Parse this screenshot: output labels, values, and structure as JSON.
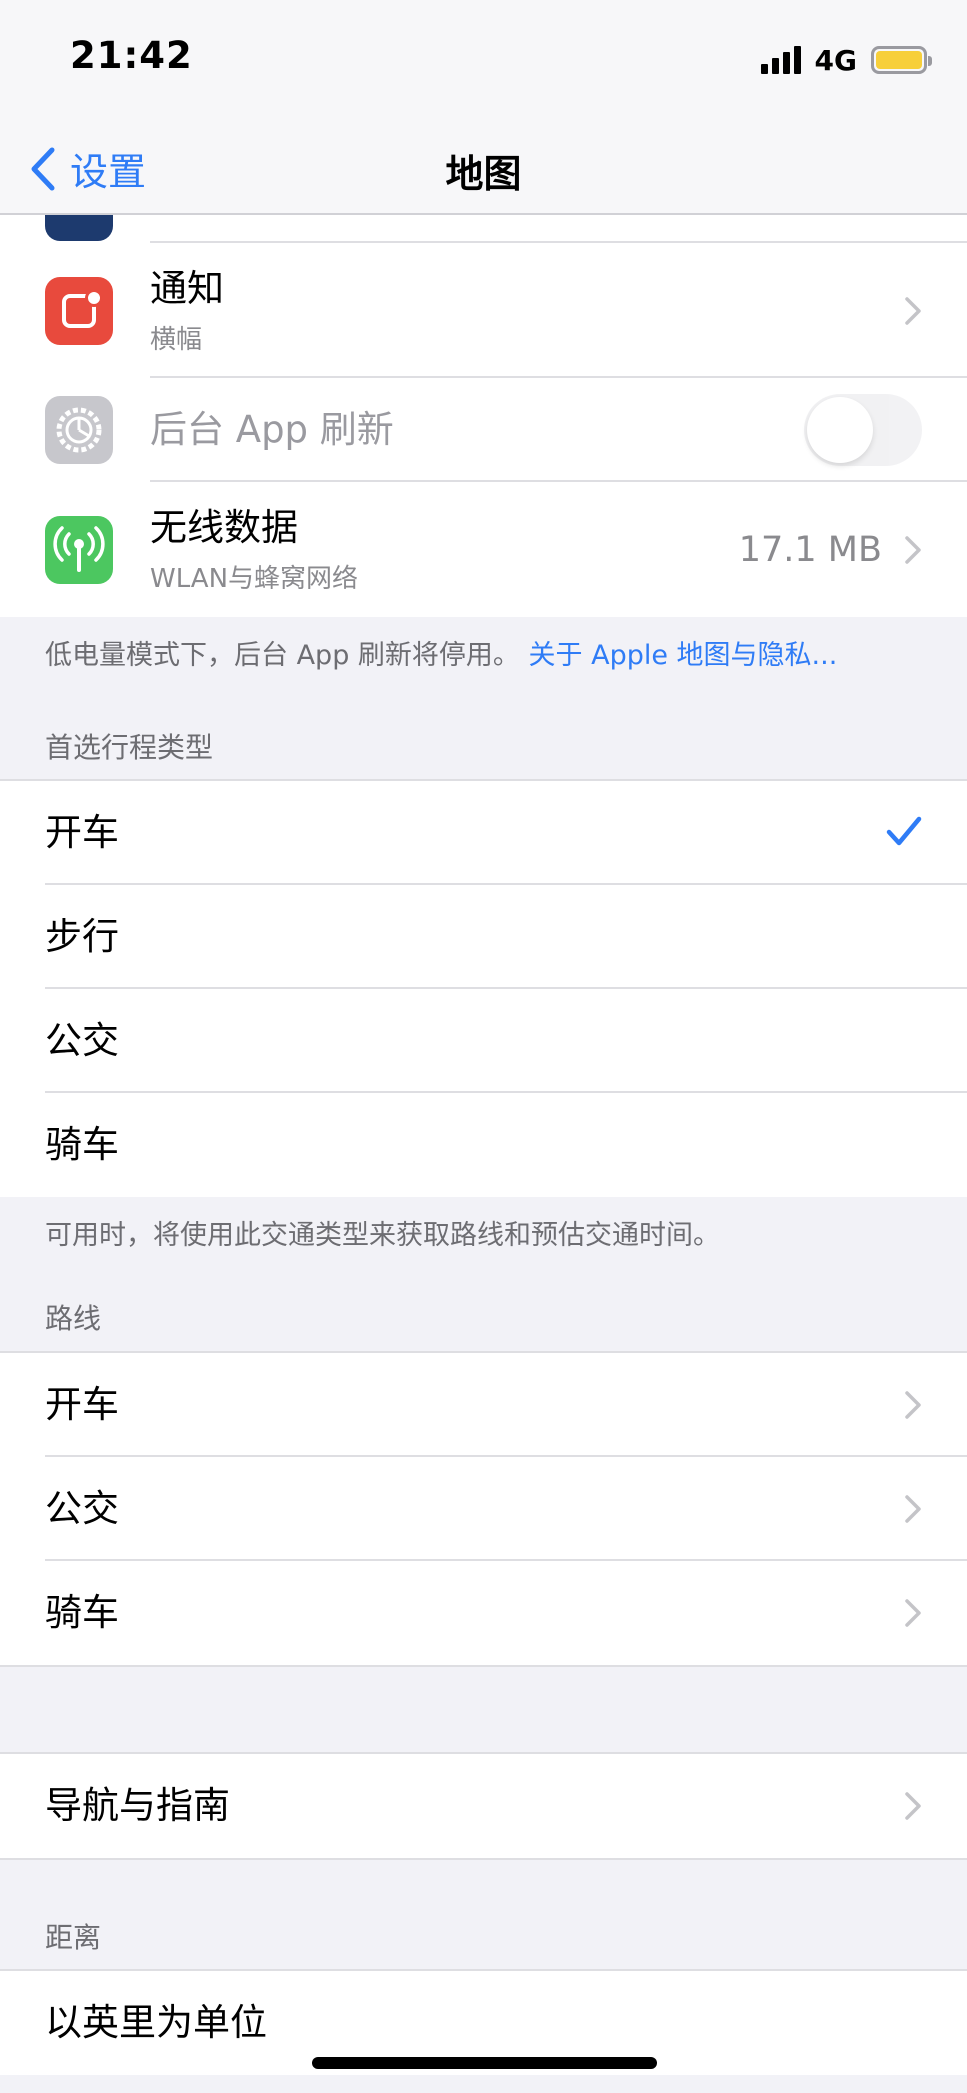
{
  "status": {
    "time": "21:42",
    "network": "4G"
  },
  "nav": {
    "back_label": "设置",
    "title": "地图"
  },
  "permissions": [
    {
      "title": "通知",
      "subtitle": "横幅",
      "icon": "notifications-icon"
    },
    {
      "title": "后台 App 刷新",
      "icon": "gear-icon",
      "toggle": "off"
    },
    {
      "title": "无线数据",
      "subtitle": "WLAN与蜂窝网络",
      "value": "17.1 MB",
      "icon": "cellular-data-icon"
    }
  ],
  "permissions_footer": {
    "text": "低电量模式下，后台 App 刷新将停用。",
    "link": "关于 Apple 地图与隐私..."
  },
  "preferred_transport": {
    "header": "首选行程类型",
    "items": [
      {
        "label": "开车",
        "selected": true
      },
      {
        "label": "步行"
      },
      {
        "label": "公交"
      },
      {
        "label": "骑车"
      }
    ],
    "footer": "可用时，将使用此交通类型来获取路线和预估交通时间。"
  },
  "routes": {
    "header": "路线",
    "items": [
      {
        "label": "开车"
      },
      {
        "label": "公交"
      },
      {
        "label": "骑车"
      }
    ]
  },
  "navigation": {
    "label": "导航与指南"
  },
  "distance": {
    "header": "距离",
    "items": [
      {
        "label": "以英里为单位"
      }
    ]
  },
  "colors": {
    "accent": "#2f7cf6",
    "notifications_icon": "#e84a3d",
    "gear_icon": "#c7c7cc",
    "cellular_icon": "#4cc760"
  }
}
